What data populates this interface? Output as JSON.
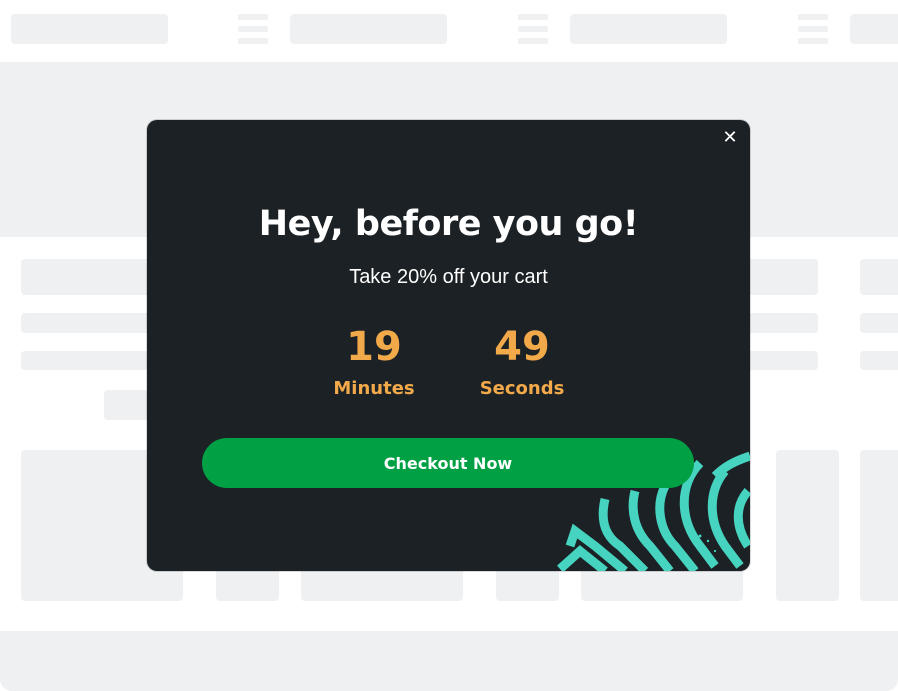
{
  "popup": {
    "close_icon": "close-icon",
    "title": "Hey, before you go!",
    "subtitle": "Take 20% off your cart",
    "timer": {
      "minutes": {
        "value": "19",
        "label": "Minutes"
      },
      "seconds": {
        "value": "49",
        "label": "Seconds"
      }
    },
    "cta_label": "Checkout Now",
    "decoration_icon": "fingerprint-icon",
    "colors": {
      "background": "#1b2124",
      "accent": "#f2a94a",
      "button": "#01a045",
      "decoration": "#46d3bf"
    }
  },
  "background": {
    "skeleton_color": "#eff0f2"
  }
}
